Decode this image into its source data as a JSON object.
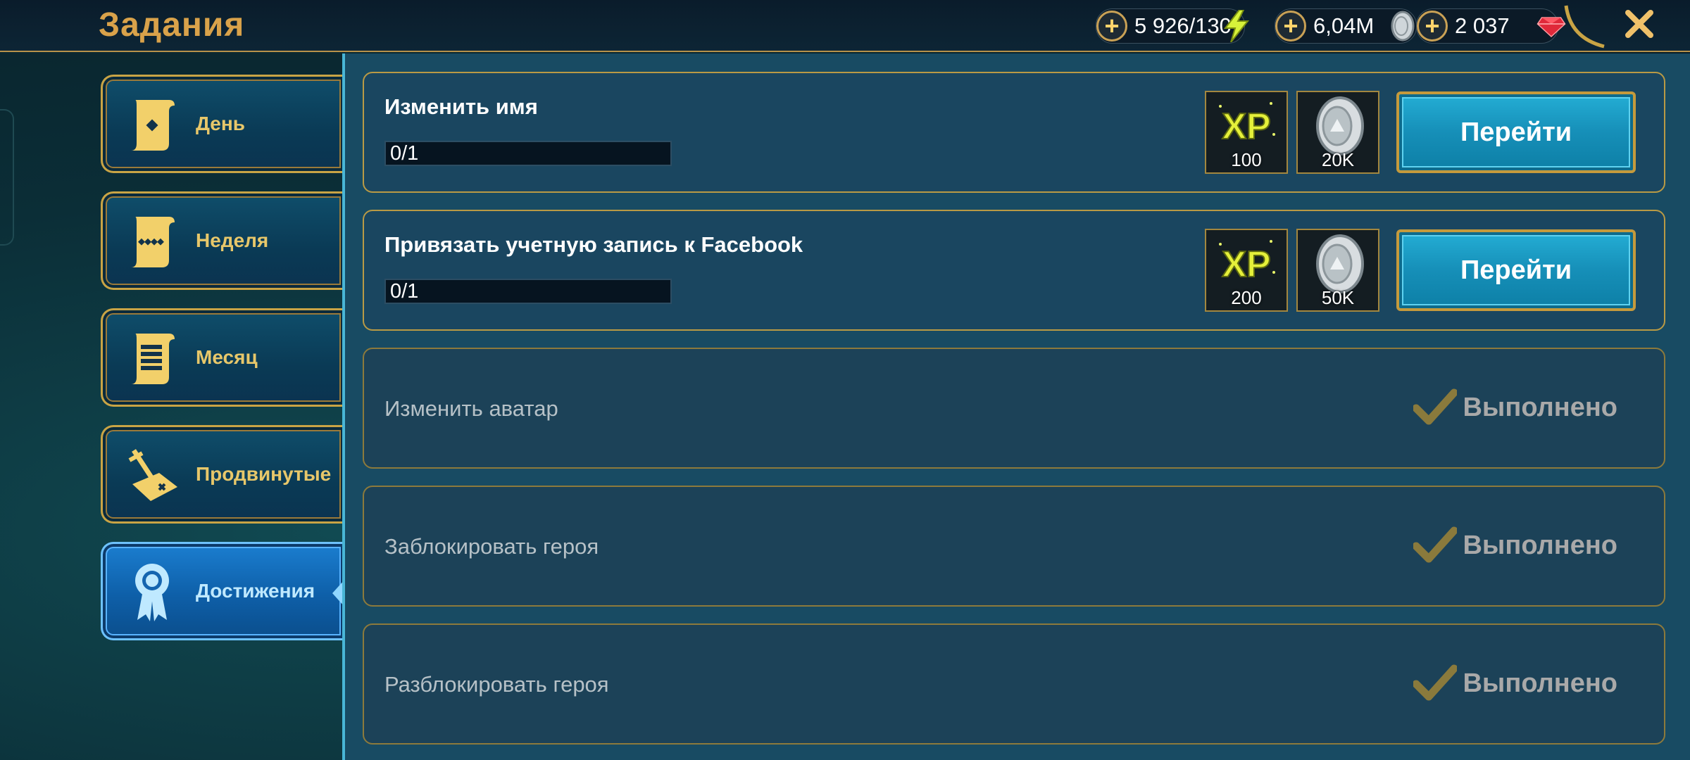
{
  "header": {
    "title": "Задания",
    "resources": [
      {
        "value": "5 926/130",
        "icon": "energy-icon"
      },
      {
        "value": "6,04M",
        "icon": "silver-coin-icon"
      },
      {
        "value": "2 037",
        "icon": "ruby-gem-icon"
      }
    ]
  },
  "nav": {
    "items": [
      {
        "label": "День",
        "icon": "scroll-icon"
      },
      {
        "label": "Неделя",
        "icon": "scroll-icon"
      },
      {
        "label": "Месяц",
        "icon": "scroll-icon"
      },
      {
        "label": "Продвинутые",
        "icon": "sword-map-icon"
      },
      {
        "label": "Достижения",
        "icon": "medal-icon",
        "active": true
      }
    ]
  },
  "quests": [
    {
      "title": "Изменить имя",
      "progress": "0/1",
      "progress_fraction": 0,
      "rewards": [
        {
          "type": "xp",
          "value": "100"
        },
        {
          "type": "silver",
          "value": "20K"
        }
      ],
      "button": "Перейти"
    },
    {
      "title": "Привязать учетную запись к Facebook",
      "progress": "0/1",
      "progress_fraction": 0,
      "rewards": [
        {
          "type": "xp",
          "value": "200"
        },
        {
          "type": "silver",
          "value": "50K"
        }
      ],
      "button": "Перейти"
    },
    {
      "title": "Изменить аватар",
      "status": "Выполнено"
    },
    {
      "title": "Заблокировать героя",
      "status": "Выполнено"
    },
    {
      "title": "Разблокировать героя",
      "status": "Выполнено"
    }
  ],
  "colors": {
    "accent_gold": "#c9a445",
    "title_gold": "#d9a24a",
    "go_button": "#168fb8",
    "active_tab": "#1b7ed0"
  }
}
